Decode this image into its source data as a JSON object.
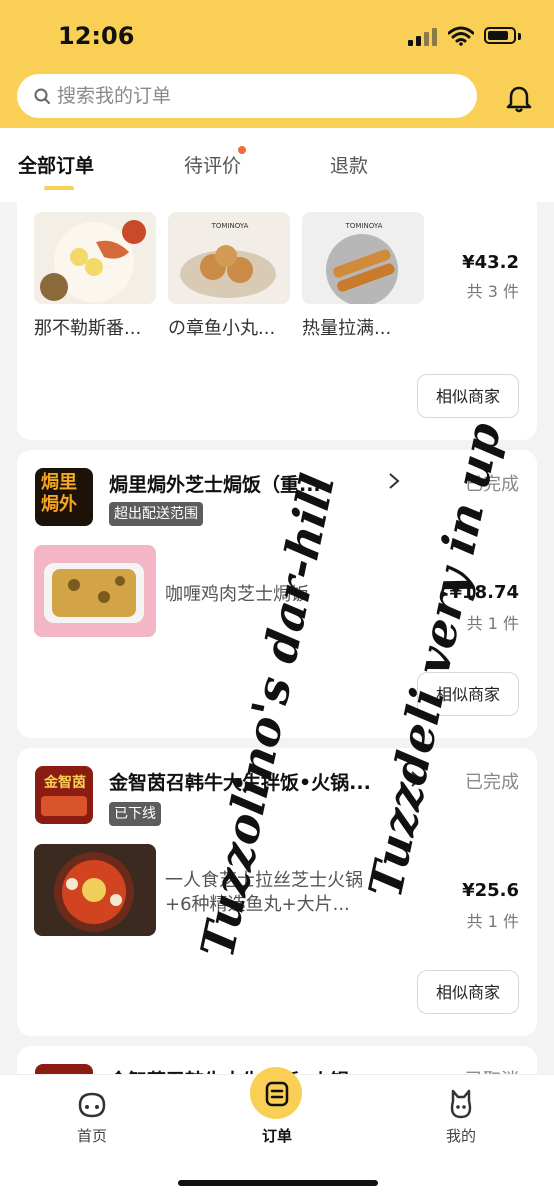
{
  "status_bar": {
    "time": "12:06"
  },
  "search": {
    "placeholder": "搜索我的订单"
  },
  "tabs": [
    {
      "label": "全部订单",
      "active": true
    },
    {
      "label": "待评价",
      "active": false,
      "dot": true
    },
    {
      "label": "退款",
      "active": false
    }
  ],
  "orders": [
    {
      "items": [
        {
          "name": "那不勒斯番..."
        },
        {
          "name": "の章鱼小丸..."
        },
        {
          "name": "热量拉满..."
        }
      ],
      "price": "¥43.2",
      "count": "共 3 件",
      "action": "相似商家"
    },
    {
      "shop": "焗里焗外芝士焗饭（重...",
      "logo_text": "焗里焗外",
      "status": "已完成",
      "tag": "超出配送范围",
      "item_name": "咖喱鸡肉芝士焗饭",
      "price": "¥18.74",
      "count": "共 1 件",
      "action": "相似商家"
    },
    {
      "shop": "金智茵召韩牛大生拌饭•火锅...",
      "logo_text": "金智茵",
      "status": "已完成",
      "tag": "已下线",
      "item_name_line1": "一人食芝士拉丝芝士火锅",
      "item_name_line2": "+6种精选鱼丸+大片...",
      "price": "¥25.6",
      "count": "共 1 件",
      "action": "相似商家"
    },
    {
      "shop": "金智茵召韩牛大生拌饭•火锅",
      "status": "已取消"
    }
  ],
  "watermark": {
    "line1": "Tuzzolino's dar-hill",
    "line2": "Tuzzdeli very in up"
  },
  "bottom_nav": [
    {
      "label": "首页",
      "icon": "home-icon"
    },
    {
      "label": "订单",
      "icon": "orders-icon",
      "active": true
    },
    {
      "label": "我的",
      "icon": "profile-icon"
    }
  ],
  "colors": {
    "brand_yellow": "#f9cf55",
    "tag_gray": "#5d5d5d",
    "dot_red": "#f26b3a"
  }
}
